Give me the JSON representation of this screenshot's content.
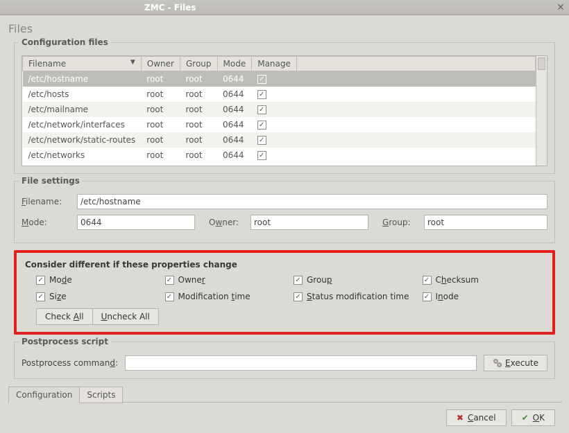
{
  "window": {
    "title": "ZMC - Files"
  },
  "header": {
    "page_title": "Files"
  },
  "config_files": {
    "frame_title": "Configuration files",
    "columns": {
      "filename": "Filename",
      "owner": "Owner",
      "group": "Group",
      "mode": "Mode",
      "manage": "Manage"
    },
    "rows": [
      {
        "filename": "/etc/hostname",
        "owner": "root",
        "group": "root",
        "mode": "0644",
        "manage": true,
        "selected": true
      },
      {
        "filename": "/etc/hosts",
        "owner": "root",
        "group": "root",
        "mode": "0644",
        "manage": true,
        "selected": false
      },
      {
        "filename": "/etc/mailname",
        "owner": "root",
        "group": "root",
        "mode": "0644",
        "manage": true,
        "selected": false
      },
      {
        "filename": "/etc/network/interfaces",
        "owner": "root",
        "group": "root",
        "mode": "0644",
        "manage": true,
        "selected": false
      },
      {
        "filename": "/etc/network/static-routes",
        "owner": "root",
        "group": "root",
        "mode": "0644",
        "manage": true,
        "selected": false
      },
      {
        "filename": "/etc/networks",
        "owner": "root",
        "group": "root",
        "mode": "0644",
        "manage": true,
        "selected": false
      }
    ]
  },
  "file_settings": {
    "frame_title": "File settings",
    "filename_label": "Filename:",
    "filename_value": "/etc/hostname",
    "mode_label": "Mode:",
    "mode_value": "0644",
    "owner_label": "Owner:",
    "owner_value": "root",
    "group_label": "Group:",
    "group_value": "root"
  },
  "consider": {
    "frame_title": "Consider different if these properties change",
    "items": [
      {
        "label": "Mode",
        "checked": true
      },
      {
        "label": "Owner",
        "checked": true
      },
      {
        "label": "Group",
        "checked": true
      },
      {
        "label": "Checksum",
        "checked": true
      },
      {
        "label": "Size",
        "checked": true
      },
      {
        "label": "Modification time",
        "checked": true
      },
      {
        "label": "Status modification time",
        "checked": true
      },
      {
        "label": "Inode",
        "checked": true
      }
    ],
    "check_all": "Check All",
    "uncheck_all": "Uncheck All"
  },
  "postprocess": {
    "frame_title": "Postprocess script",
    "label": "Postprocess command:",
    "value": "",
    "execute": "Execute"
  },
  "tabs": [
    {
      "label": "Configuration",
      "active": true
    },
    {
      "label": "Scripts",
      "active": false
    }
  ],
  "footer": {
    "cancel": "Cancel",
    "ok": "OK"
  }
}
